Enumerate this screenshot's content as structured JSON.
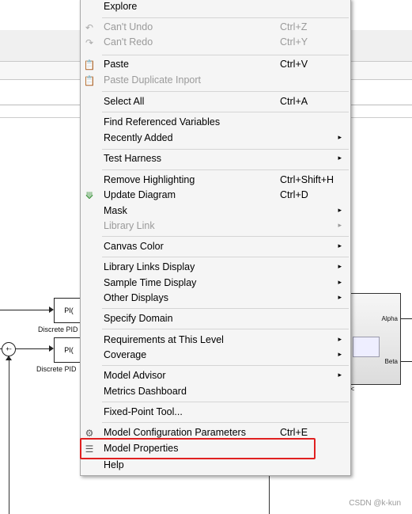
{
  "diagram": {
    "block1_label": "PI(",
    "block1_caption": "Discrete PID",
    "block2_label": "PI(",
    "block2_caption": "Discrete PID",
    "sum_symbol": "+-",
    "subsystem_port_alpha": "Alpha",
    "subsystem_port_beta": "Beta",
    "stray_char": "<"
  },
  "watermark": "CSDN @k-kun",
  "menu": {
    "items": [
      {
        "label": "Explore",
        "shortcut": "",
        "submenu": false,
        "disabled": false,
        "icon": ""
      },
      {
        "label": "Can't Undo",
        "shortcut": "Ctrl+Z",
        "submenu": false,
        "disabled": true,
        "icon": "undo-icon"
      },
      {
        "label": "Can't Redo",
        "shortcut": "Ctrl+Y",
        "submenu": false,
        "disabled": true,
        "icon": "redo-icon"
      },
      {
        "label": "Paste",
        "shortcut": "Ctrl+V",
        "submenu": false,
        "disabled": false,
        "icon": "paste-icon"
      },
      {
        "label": "Paste Duplicate Inport",
        "shortcut": "",
        "submenu": false,
        "disabled": true,
        "icon": "paste-duplicate-icon"
      },
      {
        "label": "Select All",
        "shortcut": "Ctrl+A",
        "submenu": false,
        "disabled": false,
        "icon": ""
      },
      {
        "label": "Find Referenced Variables",
        "shortcut": "",
        "submenu": false,
        "disabled": false,
        "icon": ""
      },
      {
        "label": "Recently Added",
        "shortcut": "",
        "submenu": true,
        "disabled": false,
        "icon": ""
      },
      {
        "label": "Test Harness",
        "shortcut": "",
        "submenu": true,
        "disabled": false,
        "icon": ""
      },
      {
        "label": "Remove Highlighting",
        "shortcut": "Ctrl+Shift+H",
        "submenu": false,
        "disabled": false,
        "icon": ""
      },
      {
        "label": "Update Diagram",
        "shortcut": "Ctrl+D",
        "submenu": false,
        "disabled": false,
        "icon": "update-diagram-icon"
      },
      {
        "label": "Mask",
        "shortcut": "",
        "submenu": true,
        "disabled": false,
        "icon": ""
      },
      {
        "label": "Library Link",
        "shortcut": "",
        "submenu": true,
        "disabled": true,
        "icon": ""
      },
      {
        "label": "Canvas Color",
        "shortcut": "",
        "submenu": true,
        "disabled": false,
        "icon": ""
      },
      {
        "label": "Library Links Display",
        "shortcut": "",
        "submenu": true,
        "disabled": false,
        "icon": ""
      },
      {
        "label": "Sample Time Display",
        "shortcut": "",
        "submenu": true,
        "disabled": false,
        "icon": ""
      },
      {
        "label": "Other Displays",
        "shortcut": "",
        "submenu": true,
        "disabled": false,
        "icon": ""
      },
      {
        "label": "Specify Domain",
        "shortcut": "",
        "submenu": false,
        "disabled": false,
        "icon": ""
      },
      {
        "label": "Requirements at This Level",
        "shortcut": "",
        "submenu": true,
        "disabled": false,
        "icon": ""
      },
      {
        "label": "Coverage",
        "shortcut": "",
        "submenu": true,
        "disabled": false,
        "icon": ""
      },
      {
        "label": "Model Advisor",
        "shortcut": "",
        "submenu": true,
        "disabled": false,
        "icon": ""
      },
      {
        "label": "Metrics Dashboard",
        "shortcut": "",
        "submenu": false,
        "disabled": false,
        "icon": ""
      },
      {
        "label": "Fixed-Point Tool...",
        "shortcut": "",
        "submenu": false,
        "disabled": false,
        "icon": ""
      },
      {
        "label": "Model Configuration Parameters",
        "shortcut": "Ctrl+E",
        "submenu": false,
        "disabled": false,
        "icon": "gear-icon"
      },
      {
        "label": "Model Properties",
        "shortcut": "",
        "submenu": false,
        "disabled": false,
        "icon": "properties-icon"
      },
      {
        "label": "Help",
        "shortcut": "",
        "submenu": false,
        "disabled": false,
        "icon": ""
      }
    ],
    "submenu_arrow": "▸",
    "highlight_color": "#e02020"
  }
}
